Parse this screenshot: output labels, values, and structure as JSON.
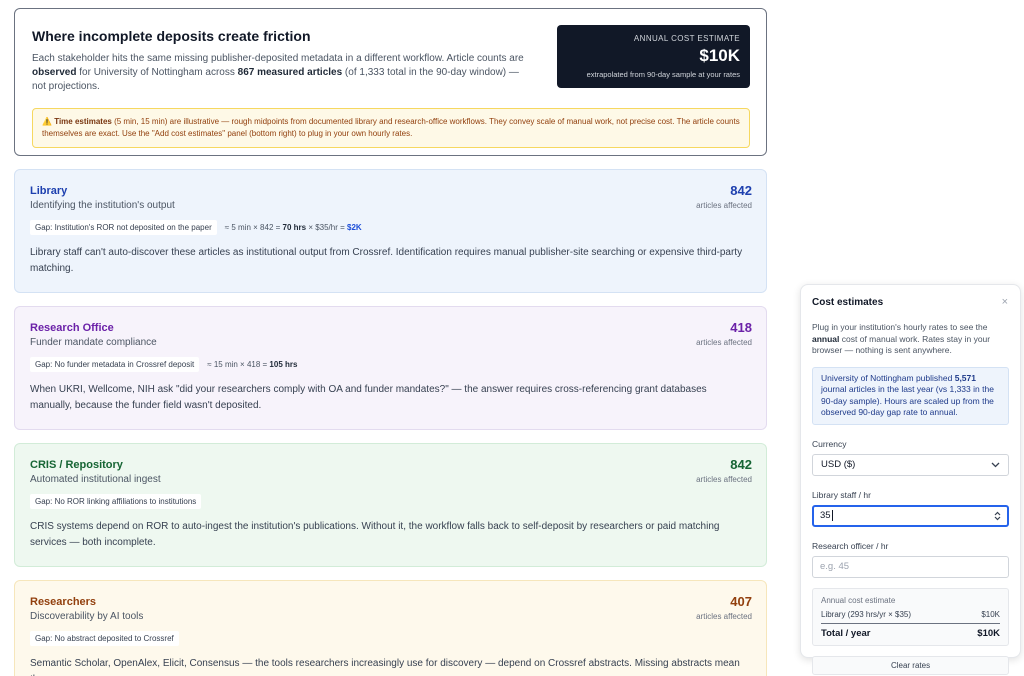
{
  "header": {
    "title": "Where incomplete deposits create friction",
    "desc_part1": "Each stakeholder hits the same missing publisher-deposited metadata in a different workflow. Article counts are ",
    "desc_bold1": "observed",
    "desc_part2": " for University of Nottingham across ",
    "desc_bold2": "867 measured articles",
    "desc_part3": " (of 1,333 total in the 90-day window) — not projections.",
    "cost_label": "ANNUAL COST ESTIMATE",
    "cost_value": "$10K",
    "cost_note": "extrapolated from 90-day sample at your rates",
    "warning_icon": "⚠️",
    "warning_bold": "Time estimates",
    "warning_text": " (5 min, 15 min) are illustrative — rough midpoints from documented library and research-office workflows. They convey scale of manual work, not precise cost. The article counts themselves are exact. Use the \"Add cost estimates\" panel (bottom right) to plug in your own hourly rates."
  },
  "stakeholders": [
    {
      "title": "Library",
      "subtitle": "Identifying the institution's output",
      "count": "842",
      "count_label": "articles affected",
      "gap": "Gap: Institution's ROR not deposited on the paper",
      "calc_pre": "≈ 5 min × 842 = ",
      "calc_hrs": "70 hrs",
      "calc_mid": " × $35/hr = ",
      "calc_cost": "$2K",
      "body": "Library staff can't auto-discover these articles as institutional output from Crossref. Identification requires manual publisher-site searching or expensive third-party matching."
    },
    {
      "title": "Research Office",
      "subtitle": "Funder mandate compliance",
      "count": "418",
      "count_label": "articles affected",
      "gap": "Gap: No funder metadata in Crossref deposit",
      "calc_pre": "≈ 15 min × 418 = ",
      "calc_hrs": "105 hrs",
      "body": "When UKRI, Wellcome, NIH ask \"did your researchers comply with OA and funder mandates?\" — the answer requires cross-referencing grant databases manually, because the funder field wasn't deposited."
    },
    {
      "title": "CRIS / Repository",
      "subtitle": "Automated institutional ingest",
      "count": "842",
      "count_label": "articles affected",
      "gap": "Gap: No ROR linking affiliations to institutions",
      "body": "CRIS systems depend on ROR to auto-ingest the institution's publications. Without it, the workflow falls back to self-deposit by researchers or paid matching services — both incomplete."
    },
    {
      "title": "Researchers",
      "subtitle": "Discoverability by AI tools",
      "count": "407",
      "count_label": "articles affected",
      "gap": "Gap: No abstract deposited to Crossref",
      "body": "Semantic Scholar, OpenAlex, Elicit, Consensus — the tools researchers increasingly use for discovery — depend on Crossref abstracts. Missing abstracts mean the"
    }
  ],
  "panel": {
    "title": "Cost estimates",
    "close": "×",
    "desc_pre": "Plug in your institution's hourly rates to see the ",
    "desc_bold": "annual",
    "desc_post": " cost of manual work. Rates stay in your browser — nothing is sent anywhere.",
    "info_pre": "University of Nottingham published ",
    "info_bold": "5,571",
    "info_post": " journal articles in the last year (vs 1,333 in the 90-day sample). Hours are scaled up from the observed 90-day gap rate to annual.",
    "currency_label": "Currency",
    "currency_value": "USD ($)",
    "library_label": "Library staff / hr",
    "library_value": "35",
    "research_label": "Research officer / hr",
    "research_placeholder": "e.g. 45",
    "estimate_label": "Annual cost estimate",
    "estimate_row_label": "Library (293 hrs/yr × $35)",
    "estimate_row_value": "$10K",
    "total_label": "Total / year",
    "total_value": "$10K",
    "clear_label": "Clear rates"
  }
}
